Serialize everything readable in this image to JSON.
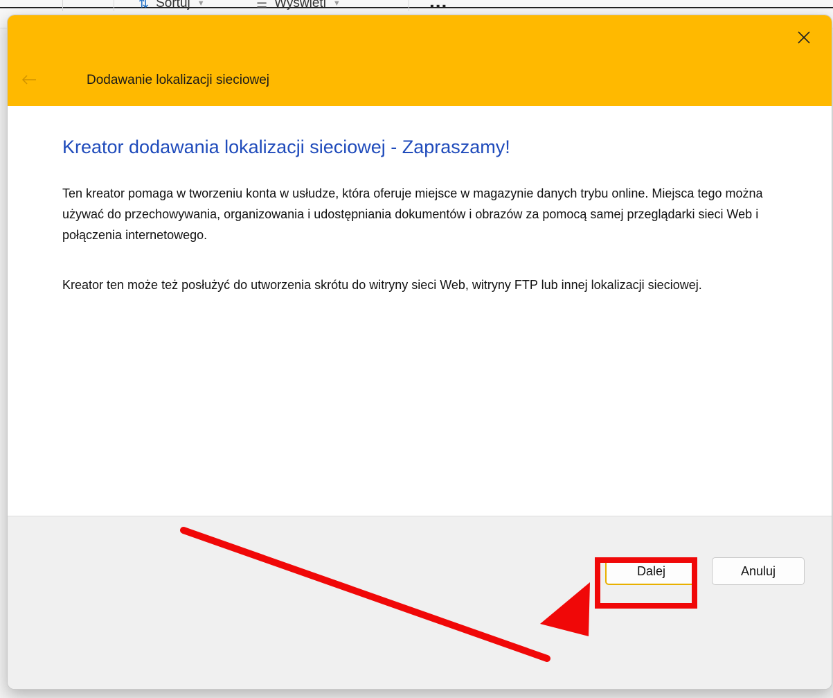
{
  "background_toolbar": {
    "sort_label": "Sortuj",
    "view_label": "Wyświetl",
    "more_label": "..."
  },
  "dialog": {
    "title": "Dodawanie lokalizacji sieciowej",
    "heading": "Kreator dodawania lokalizacji sieciowej - Zapraszamy!",
    "paragraph1": "Ten kreator pomaga w tworzeniu konta w usłudze, która oferuje miejsce w magazynie danych trybu online. Miejsca tego można używać do przechowywania, organizowania i udostępniania dokumentów i obrazów za pomocą samej przeglądarki sieci Web i połączenia internetowego.",
    "paragraph2": "Kreator ten może też posłużyć do utworzenia skrótu do witryny sieci Web, witryny FTP  lub innej lokalizacji sieciowej.",
    "buttons": {
      "next": "Dalej",
      "cancel": "Anuluj"
    }
  },
  "icons": {
    "close": "close-icon",
    "back": "back-arrow-icon",
    "sort": "sort-icon",
    "view": "view-icon"
  },
  "colors": {
    "titlebar": "#ffb900",
    "heading": "#1f4bbb",
    "annotation": "#f00808"
  }
}
